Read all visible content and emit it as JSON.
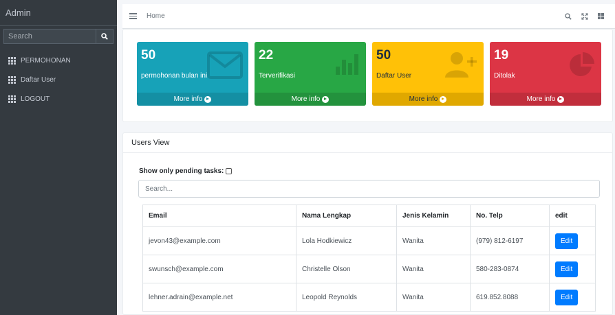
{
  "sidebar": {
    "brand": "Admin",
    "search_placeholder": "Search",
    "items": [
      {
        "label": "PERMOHONAN"
      },
      {
        "label": "Daftar User"
      },
      {
        "label": "LOGOUT"
      }
    ]
  },
  "topbar": {
    "home_label": "Home"
  },
  "boxes": [
    {
      "value": "50",
      "label": "permohonan bulan ini",
      "footer": "More info",
      "color": "#17a2b8",
      "icon": "envelope-icon"
    },
    {
      "value": "22",
      "label": "Terverifikasi",
      "footer": "More info",
      "color": "#28a745",
      "icon": "bar-chart-icon"
    },
    {
      "value": "50",
      "label": "Daftar User",
      "footer": "More info",
      "color": "#ffc107",
      "icon": "user-plus-icon"
    },
    {
      "value": "19",
      "label": "Ditolak",
      "footer": "More info",
      "color": "#dc3545",
      "icon": "pie-chart-icon"
    }
  ],
  "users_view": {
    "title": "Users View",
    "filter_label": "Show only pending tasks:",
    "search_placeholder": "Search...",
    "columns": [
      "Email",
      "Nama Lengkap",
      "Jenis Kelamin",
      "No. Telp",
      "edit"
    ],
    "rows": [
      {
        "email": "jevon43@example.com",
        "name": "Lola Hodkiewicz",
        "gender": "Wanita",
        "phone": "(979) 812-6197",
        "action": "Edit"
      },
      {
        "email": "swunsch@example.com",
        "name": "Christelle Olson",
        "gender": "Wanita",
        "phone": "580-283-0874",
        "action": "Edit"
      },
      {
        "email": "lehner.adrain@example.net",
        "name": "Leopold Reynolds",
        "gender": "Wanita",
        "phone": "619.852.8088",
        "action": "Edit"
      }
    ]
  }
}
